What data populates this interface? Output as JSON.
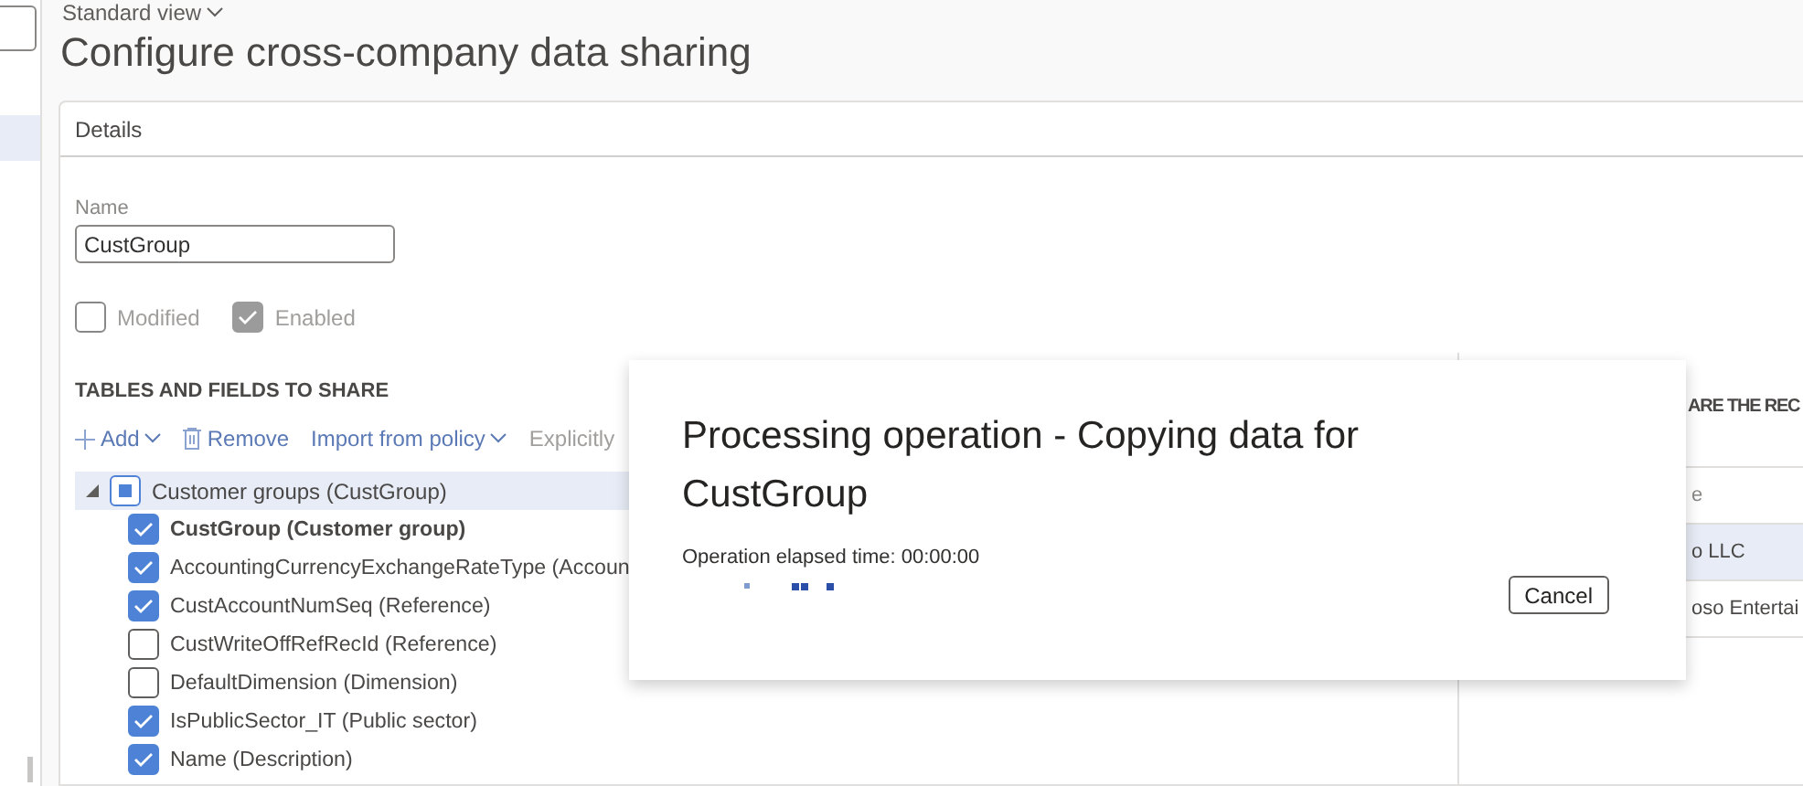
{
  "view_selector": {
    "label": "Standard view"
  },
  "page_title": "Configure cross-company data sharing",
  "details": {
    "header": "Details",
    "name_label": "Name",
    "name_value": "CustGroup",
    "checks": [
      {
        "label": "Modified",
        "checked": false,
        "disabled": true
      },
      {
        "label": "Enabled",
        "checked": true,
        "disabled": true
      }
    ]
  },
  "tables": {
    "heading": "TABLES AND FIELDS TO SHARE",
    "toolbar": [
      {
        "kind": "add",
        "label": "Add"
      },
      {
        "kind": "remove",
        "label": "Remove"
      },
      {
        "kind": "menu",
        "label": "Import from policy"
      },
      {
        "kind": "text",
        "label": "Explicitly"
      }
    ],
    "tree": [
      {
        "label": "Customer groups (CustGroup)",
        "indeterminate": true,
        "selected": true,
        "expanded": true,
        "children": [
          {
            "label": "CustGroup (Customer group)",
            "checked": true,
            "key_field": true
          },
          {
            "label": "AccountingCurrencyExchangeRateType (Accoun",
            "checked": true,
            "key_field": false
          },
          {
            "label": "CustAccountNumSeq (Reference)",
            "checked": true,
            "key_field": false
          },
          {
            "label": "CustWriteOffRefRecId (Reference)",
            "checked": false,
            "key_field": false
          },
          {
            "label": "DefaultDimension (Dimension)",
            "checked": false,
            "key_field": false
          },
          {
            "label": "IsPublicSector_IT (Public sector)",
            "checked": true,
            "key_field": false
          },
          {
            "label": "Name (Description)",
            "checked": true,
            "key_field": false
          }
        ]
      }
    ]
  },
  "companies": {
    "heading": "ARE THE REC",
    "column_1": "e",
    "rows": [
      {
        "cell": "o LLC",
        "selected": true
      },
      {
        "cell": "oso Entertai",
        "selected": false
      }
    ]
  },
  "dialog": {
    "title": "Processing operation - Copying data for CustGroup",
    "elapsed": "Operation elapsed time: 00:00:00",
    "button": "Cancel"
  }
}
